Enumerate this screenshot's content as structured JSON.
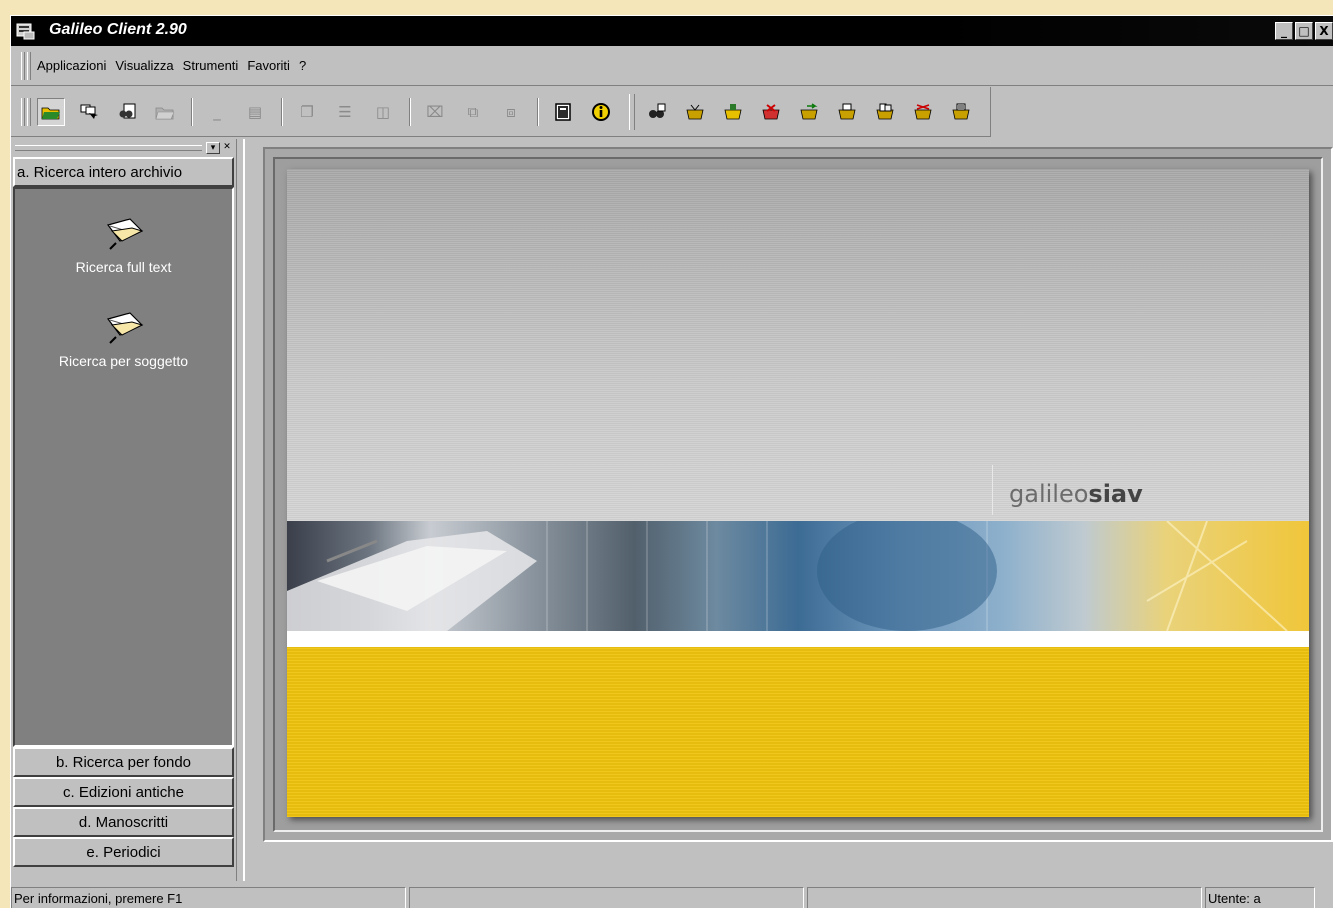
{
  "window": {
    "title": "Galileo Client 2.90",
    "buttons": [
      "_",
      "□",
      "X"
    ]
  },
  "menu": {
    "items": [
      {
        "label": "Applicazioni"
      },
      {
        "label": "Visualizza"
      },
      {
        "label": "Strumenti"
      },
      {
        "label": "Favoriti"
      },
      {
        "label": "?"
      }
    ]
  },
  "toolbar": {
    "icons": [
      "open-folder-icon",
      "search-pointer-icon",
      "binoculars-doc-icon",
      "folder-open-icon",
      "minimize-doc-icon",
      "tile-icon",
      "cascade-icon",
      "tile-horizontal-icon",
      "tile-vertical-icon",
      "close-doc-icon",
      "close-all-icon",
      "close-others-icon",
      "book-icon",
      "info-icon",
      "find-icon",
      "basket-add-icon",
      "basket-icon",
      "basket-remove-icon",
      "basket-move-icon",
      "basket-print-icon",
      "basket-export-icon",
      "basket-send-icon",
      "basket-clear-icon"
    ]
  },
  "leftpanel": {
    "active_tab": "a. Ricerca intero archivio",
    "items": [
      {
        "label": "Ricerca full text"
      },
      {
        "label": "Ricerca per soggetto"
      }
    ],
    "tabs": [
      {
        "label": "b. Ricerca per fondo"
      },
      {
        "label": "c. Edizioni antiche"
      },
      {
        "label": "d. Manoscritti"
      },
      {
        "label": "e. Periodici"
      }
    ]
  },
  "splash": {
    "brand_light": "galileo",
    "brand_bold": "siav",
    "colors": {
      "yellow": "#efc50f",
      "gray": "#c0c0c0"
    }
  },
  "status": {
    "help": "Per informazioni, premere F1",
    "user": "Utente: a"
  }
}
